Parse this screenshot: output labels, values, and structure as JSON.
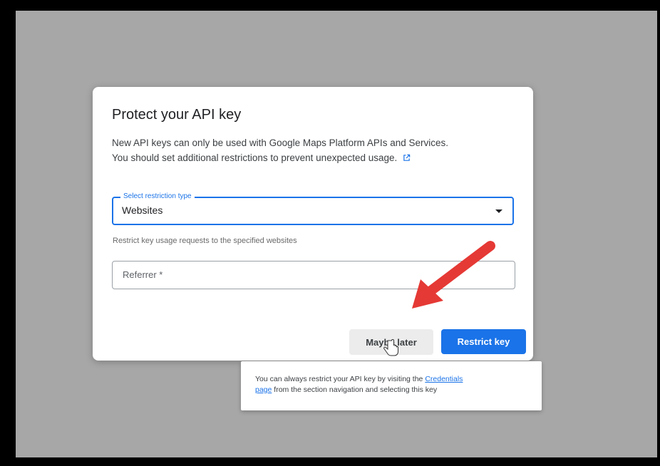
{
  "dialog": {
    "title": "Protect your API key",
    "description_line1": "New API keys can only be used with Google Maps Platform APIs and Services.",
    "description_line2": "You should set additional restrictions to prevent unexpected usage.",
    "external_link_icon": "external-link-icon",
    "restriction_select": {
      "label": "Select restriction type",
      "value": "Websites"
    },
    "helper_text": "Restrict key usage requests to the specified websites",
    "referrer_input": {
      "placeholder": "Referrer *",
      "value": ""
    },
    "buttons": {
      "maybe_later": "Maybe later",
      "restrict_key": "Restrict key"
    }
  },
  "tooltip": {
    "text_before": "You can always restrict your API key by visiting the",
    "link_part1": "Credentials",
    "link_part2": "page",
    "text_after": "from the section navigation and selecting this key"
  },
  "colors": {
    "accent": "#1a73e8",
    "annotation_arrow": "#e53935",
    "backdrop": "#a7a7a7"
  }
}
